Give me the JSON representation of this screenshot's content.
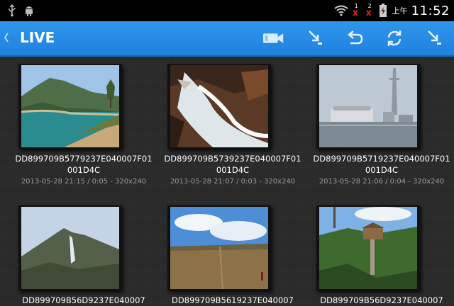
{
  "status_bar": {
    "left_icons": [
      "usb-icon",
      "android-debug-icon"
    ],
    "signal_1": {
      "number": "1",
      "mark": "x"
    },
    "signal_2": {
      "number": "2",
      "mark": "x"
    },
    "ampm": "上午",
    "time": "11:52"
  },
  "action_bar": {
    "title": "LIVE",
    "buttons": [
      "video-camera-icon",
      "download-icon",
      "undo-icon",
      "refresh-icon",
      "download-icon"
    ],
    "color": "#1f86e2"
  },
  "videos": [
    {
      "name": "DD899709B5779237E040007F01001D4C",
      "meta": "2013-05-28 21:15 / 0:05 - 320x240"
    },
    {
      "name": "DD899709B5739237E040007F01001D4C",
      "meta": "2013-05-28 21:07 / 0:03 - 320x240"
    },
    {
      "name": "DD899709B5719237E040007F01001D4C",
      "meta": "2013-05-28 21:06 / 0:04 - 320x240"
    },
    {
      "name": "DD899709B56D9237E040007",
      "meta": ""
    },
    {
      "name": "DD899709B5619237E040007",
      "meta": ""
    },
    {
      "name": "DD899709B56D9237E040007",
      "meta": ""
    }
  ]
}
